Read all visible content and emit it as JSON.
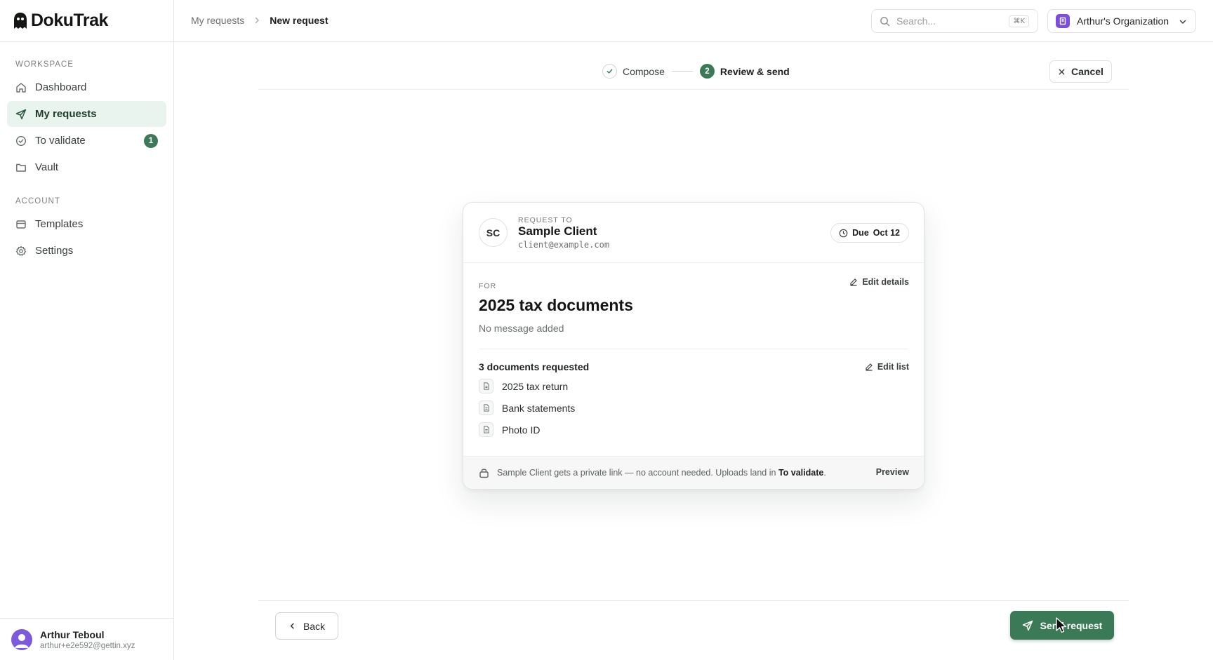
{
  "app": {
    "name": "DokuTrak"
  },
  "sidebar": {
    "workspace_label": "WORKSPACE",
    "workspace_items": [
      {
        "label": "Dashboard",
        "icon": "home-icon"
      },
      {
        "label": "My requests",
        "icon": "send-icon",
        "active": true
      },
      {
        "label": "To validate",
        "icon": "check-circle-icon",
        "badge": "1"
      },
      {
        "label": "Vault",
        "icon": "folder-icon"
      }
    ],
    "account_label": "ACCOUNT",
    "account_items": [
      {
        "label": "Templates",
        "icon": "template-icon"
      },
      {
        "label": "Settings",
        "icon": "gear-icon"
      }
    ],
    "user": {
      "name": "Arthur Teboul",
      "email": "arthur+e2e592@gettin.xyz"
    }
  },
  "topbar": {
    "breadcrumb": {
      "parent": "My requests",
      "current": "New request"
    },
    "search": {
      "placeholder": "Search...",
      "shortcut": "⌘K"
    },
    "org": {
      "name": "Arthur's Organization"
    }
  },
  "steps": {
    "items": [
      {
        "label": "Compose",
        "state": "done"
      },
      {
        "label": "Review & send",
        "number": "2",
        "state": "current"
      }
    ],
    "cancel_label": "Cancel"
  },
  "card": {
    "recipient": {
      "initials": "SC",
      "label": "REQUEST TO",
      "name": "Sample Client",
      "email": "client@example.com"
    },
    "due": {
      "label": "Due",
      "date": "Oct 12"
    },
    "for_label": "FOR",
    "edit_details_label": "Edit details",
    "title": "2025 tax documents",
    "message": "No message added",
    "documents_heading": "3 documents requested",
    "edit_list_label": "Edit list",
    "documents": [
      "2025 tax return",
      "Bank statements",
      "Photo ID"
    ],
    "footer": {
      "text_before": "Sample Client gets a private link — no account needed. Uploads land in ",
      "highlight": "To validate",
      "text_after": ".",
      "preview_label": "Preview"
    }
  },
  "actions": {
    "back_label": "Back",
    "send_label": "Send request"
  },
  "colors": {
    "accent": "#3a7a56",
    "active_bg": "#eaf4ee",
    "org_icon": "#7a4fe0",
    "avatar": "#7b5bdc"
  }
}
